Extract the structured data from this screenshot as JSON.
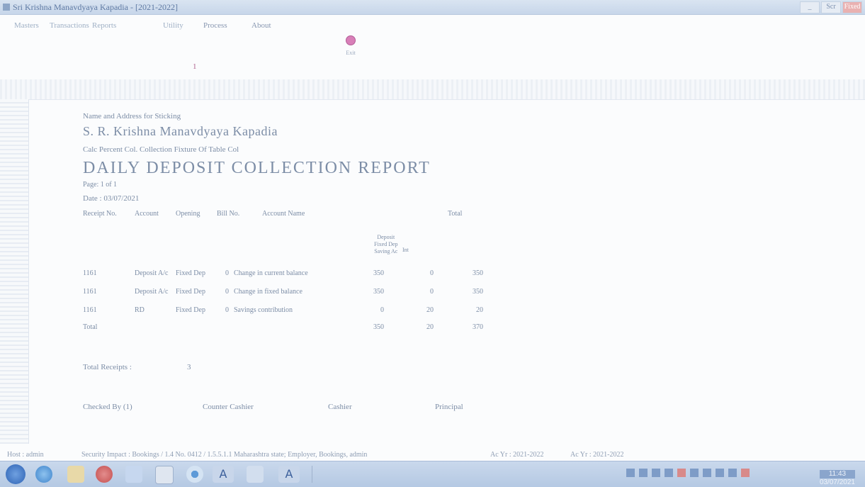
{
  "window": {
    "title": "Sri Krishna Manavdyaya Kapadia - [2021-2022]",
    "controls": [
      "_",
      "Scr",
      "Fixed"
    ]
  },
  "menu": [
    "Masters",
    "Transactions",
    "Reports",
    "Utility",
    "Process",
    "About"
  ],
  "toolbar": {
    "exit_label": "Exit",
    "marker": "1"
  },
  "report": {
    "company_label": "Name and Address for Sticking",
    "company_name": "S. R. Krishna Manavdyaya Kapadia",
    "calc_label": "Calc Percent Col. Collection Fixture Of Table Col",
    "title": "DAILY DEPOSIT COLLECTION REPORT",
    "page": "Page: 1 of 1",
    "date": "Date : 03/07/2021",
    "headers": [
      "Receipt No.",
      "Account",
      "Opening",
      "Bill No.",
      "Account Name",
      "",
      "Total"
    ],
    "subhead_lines": [
      "Deposit",
      "Fixed Dep",
      "Saving Ac"
    ],
    "subhead2": "Int",
    "rows": [
      {
        "no": "1161",
        "acc": "Deposit A/c",
        "type": "Fixed Dep",
        "bill": "0",
        "name": "Change in current balance",
        "amt1": "350",
        "amt2": "0",
        "total": "350"
      },
      {
        "no": "1161",
        "acc": "Deposit A/c",
        "type": "Fixed Dep",
        "bill": "0",
        "name": "Change in fixed balance",
        "amt1": "350",
        "amt2": "0",
        "total": "350"
      },
      {
        "no": "1161",
        "acc": "RD",
        "type": "Fixed Dep",
        "bill": "0",
        "name": "Savings contribution",
        "amt1": "0",
        "amt2": "20",
        "total": "20"
      }
    ],
    "total_row": {
      "label": "Total",
      "amt1": "350",
      "amt2": "20",
      "total": "370"
    },
    "totals_label": "Total Receipts :",
    "totals_value": "3",
    "footer": [
      "Checked By (1)",
      "Counter Cashier",
      "Cashier",
      "Principal"
    ]
  },
  "statusbar": {
    "left": "Host : admin",
    "middle": "Security Impact : Bookings / 1.4 No. 0412 / 1.5.5.1.1 Maharashtra state; Employer, Bookings, admin",
    "fy1": "Ac Yr : 2021-2022",
    "fy2": "Ac Yr : 2021-2022"
  },
  "taskbar": {
    "tally_label": "A",
    "clock_time": "11:43",
    "clock_date": "03/07/2021"
  },
  "colors": {
    "accent": "#d87fb8",
    "text": "#7c8da6",
    "taskbar": "#b5c9e3"
  }
}
